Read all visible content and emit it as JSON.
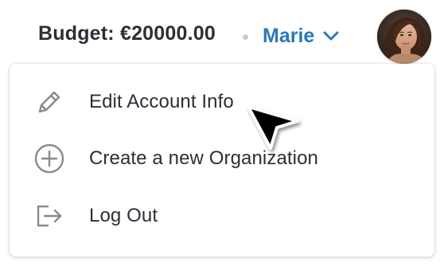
{
  "header": {
    "budget_text": "Budget: €20000.00",
    "user_name": "Marie"
  },
  "menu": {
    "items": [
      {
        "label": "Edit Account Info",
        "icon": "pencil-icon"
      },
      {
        "label": "Create a new Organization",
        "icon": "plus-circle-icon"
      },
      {
        "label": "Log Out",
        "icon": "logout-icon"
      }
    ]
  },
  "colors": {
    "accent": "#2a78b8",
    "text": "#2b2f36",
    "icon": "#8a8a8a",
    "separator_dot": "#c9cdd2"
  }
}
